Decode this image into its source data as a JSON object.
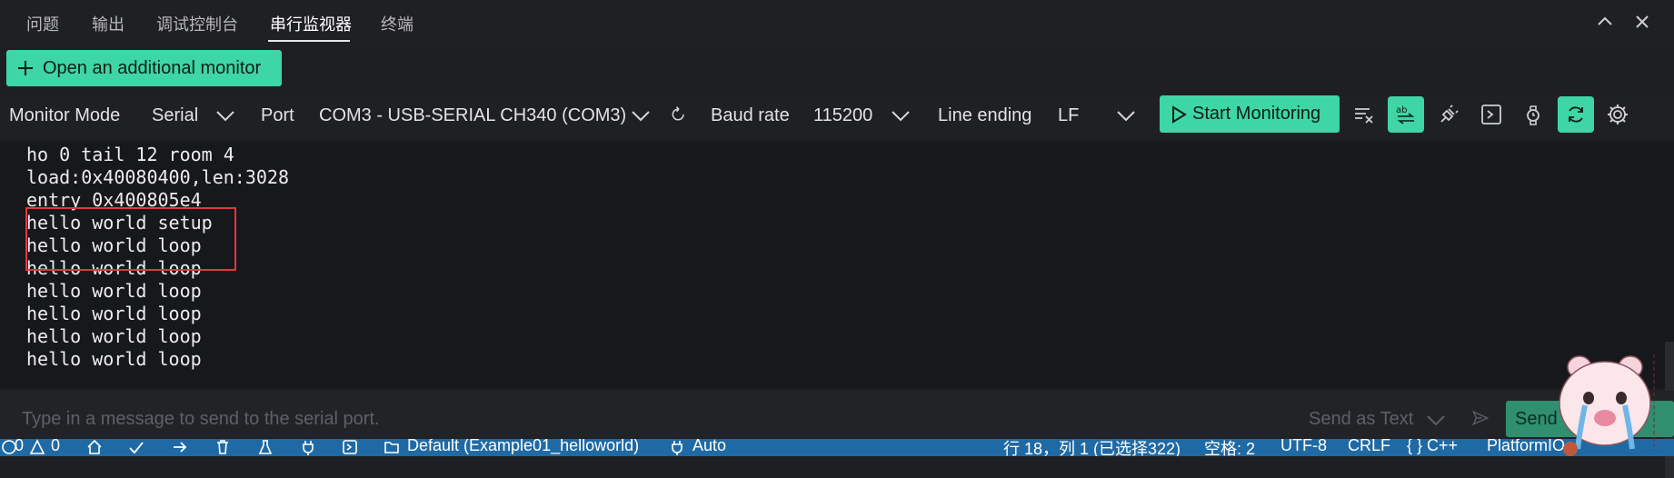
{
  "tabs": [
    {
      "label": "问题",
      "active": false
    },
    {
      "label": "输出",
      "active": false
    },
    {
      "label": "调试控制台",
      "active": false
    },
    {
      "label": "串行监视器",
      "active": true
    },
    {
      "label": "终端",
      "active": false
    }
  ],
  "open_monitor_label": "Open an additional monitor",
  "toolbar": {
    "monitor_mode_label": "Monitor Mode",
    "monitor_mode_value": "Serial",
    "port_label": "Port",
    "port_value": "COM3 - USB-SERIAL CH340 (COM3)",
    "baud_label": "Baud rate",
    "baud_value": "115200",
    "line_ending_label": "Line ending",
    "line_ending_value": "LF",
    "start_label": "Start Monitoring"
  },
  "output_lines": [
    "ho 0 tail 12 room 4",
    "load:0x40080400,len:3028",
    "entry 0x400805e4",
    "hello world setup",
    "hello world loop",
    "hello world loop",
    "hello world loop",
    "hello world loop",
    "hello world loop",
    "hello world loop"
  ],
  "send": {
    "placeholder": "Type in a message to send to the serial port.",
    "send_as_label": "Send as Text",
    "send_label": "Send"
  },
  "status": {
    "errors": "0",
    "warnings": "0",
    "env": "Default (Example01_helloworld)",
    "auto": "Auto",
    "position": "行 18，列 1 (已选择322)",
    "spaces": "空格: 2",
    "encoding": "UTF-8",
    "eol": "CRLF",
    "language": "{ } C++",
    "platform": "PlatformIO"
  },
  "colors": {
    "accent": "#3dd6a4",
    "highlight_box": "#e0393e",
    "statusbar": "#1f6aa5"
  }
}
